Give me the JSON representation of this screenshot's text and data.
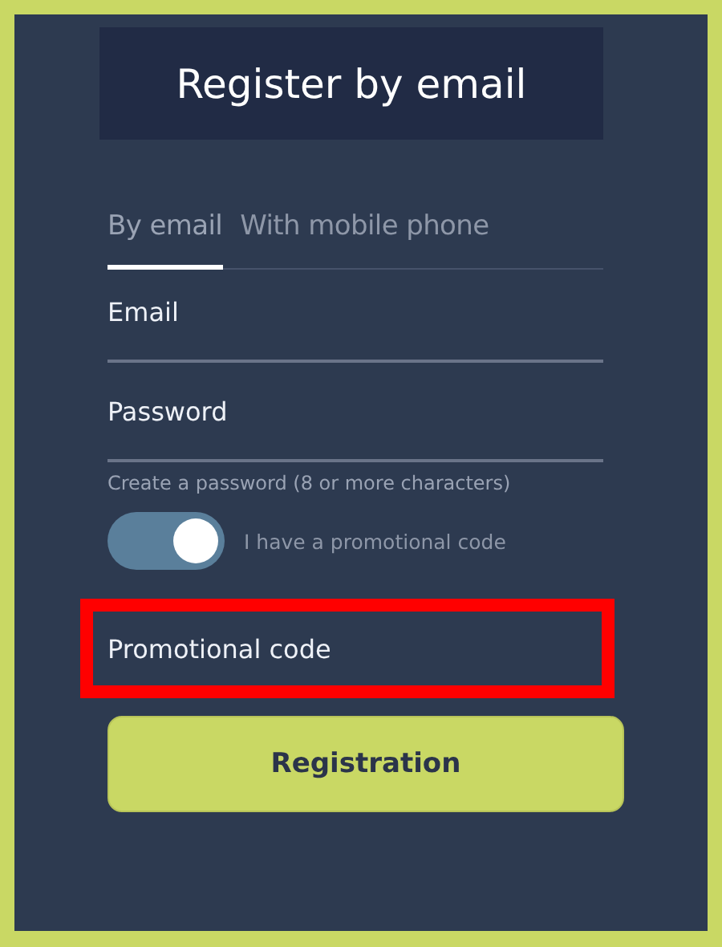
{
  "header": {
    "title": "Register by email"
  },
  "tabs": [
    {
      "label": "By email",
      "selected": true
    },
    {
      "label": "With mobile phone",
      "selected": false
    }
  ],
  "fields": [
    {
      "placeholder": "Email",
      "underlined": true
    },
    {
      "placeholder": "Password",
      "underlined": true,
      "hint": "Create a password (8 or more characters)"
    }
  ],
  "promo_toggle": {
    "label": "I have a promotional code",
    "on": true
  },
  "promo_field": {
    "placeholder": "Promotional code",
    "highlighted": true
  },
  "buttons": [
    {
      "label": "Registration"
    }
  ]
}
